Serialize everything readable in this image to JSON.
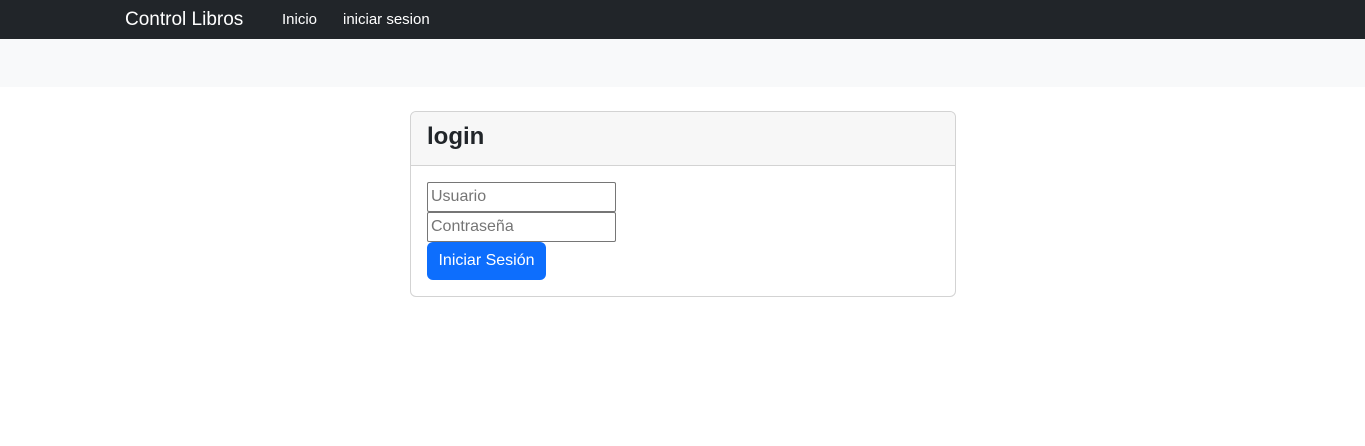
{
  "navbar": {
    "brand": "Control Libros",
    "links": [
      {
        "label": "Inicio"
      },
      {
        "label": "iniciar sesion"
      }
    ]
  },
  "login_card": {
    "title": "login",
    "username": {
      "placeholder": "Usuario",
      "value": ""
    },
    "password": {
      "placeholder": "Contraseña",
      "value": ""
    },
    "submit_label": "Iniciar Sesión"
  },
  "colors": {
    "navbar_bg": "#212529",
    "subbar_bg": "#f8f9fa",
    "primary": "#0d6efd"
  }
}
